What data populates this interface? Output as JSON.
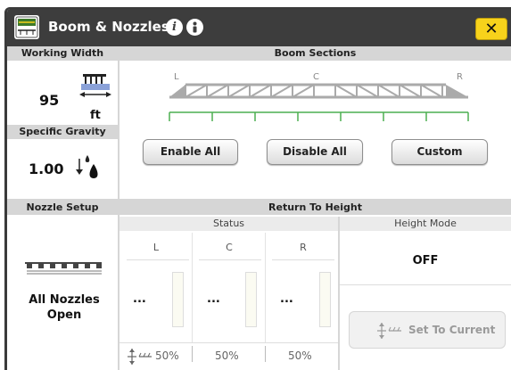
{
  "window": {
    "title": "Boom & Nozzles",
    "close_label": "✕",
    "app_icon": "sprayer-icon",
    "info_icon": "i",
    "help_icon": "help-icon"
  },
  "working_width": {
    "header": "Working Width",
    "value": "95",
    "unit": "ft"
  },
  "specific_gravity": {
    "header": "Specific Gravity",
    "value": "1.00"
  },
  "boom_sections": {
    "header": "Boom Sections",
    "label_left": "L",
    "label_center": "C",
    "label_right": "R",
    "section_count": 7,
    "enable_all": "Enable All",
    "disable_all": "Disable All",
    "custom": "Custom",
    "accent_color": "#4caf50"
  },
  "nozzle_setup": {
    "header": "Nozzle Setup",
    "status": "All Nozzles Open"
  },
  "return_to_height": {
    "header": "Return To Height",
    "status_header": "Status",
    "height_mode_header": "Height Mode",
    "height_mode_value": "OFF",
    "set_to_current": "Set To Current",
    "columns": [
      {
        "label": "L",
        "value": "...",
        "percent": "50%"
      },
      {
        "label": "C",
        "value": "...",
        "percent": "50%"
      },
      {
        "label": "R",
        "value": "...",
        "percent": "50%"
      }
    ]
  }
}
